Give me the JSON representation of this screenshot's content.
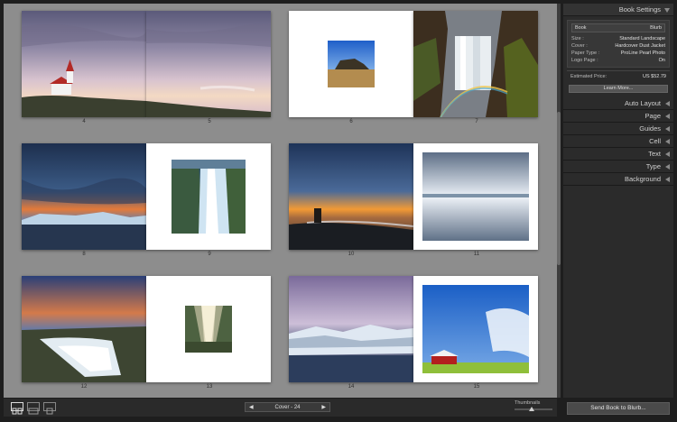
{
  "spreads": [
    {
      "left_page": "4",
      "right_page": "5",
      "content": "church-panorama"
    },
    {
      "left_page": "6",
      "right_page": "7",
      "content": "mountain-and-waterfall"
    },
    {
      "left_page": "8",
      "right_page": "9",
      "content": "iceberg-sunset-and-waterfall"
    },
    {
      "left_page": "10",
      "right_page": "11",
      "content": "black-beach-and-cloud-reflection"
    },
    {
      "left_page": "12",
      "right_page": "13",
      "content": "gullfoss-and-light-rays"
    },
    {
      "left_page": "14",
      "right_page": "15",
      "content": "glacier-lagoon-and-red-barn"
    }
  ],
  "panel": {
    "book_settings_title": "Book Settings",
    "book_label": "Book",
    "book_value": "Blurb",
    "rows": [
      {
        "label": "Size :",
        "value": "Standard Landscape"
      },
      {
        "label": "Cover :",
        "value": "Hardcover Dust Jacket"
      },
      {
        "label": "Paper Type :",
        "value": "ProLine Pearl Photo"
      },
      {
        "label": "Logo Page :",
        "value": "On"
      }
    ],
    "price_label": "Estimated Price:",
    "price_value": "US $52.79",
    "learn_more": "Learn More...",
    "sections": [
      "Auto Layout",
      "Page",
      "Guides",
      "Cell",
      "Text",
      "Type",
      "Background"
    ]
  },
  "send_button": "Send Book to Blurb...",
  "toolbar": {
    "page_label": "Cover - 24",
    "prev": "◀",
    "next": "▶",
    "thumbnails_label": "Thumbnails",
    "thumbnail_size": 0.45
  }
}
